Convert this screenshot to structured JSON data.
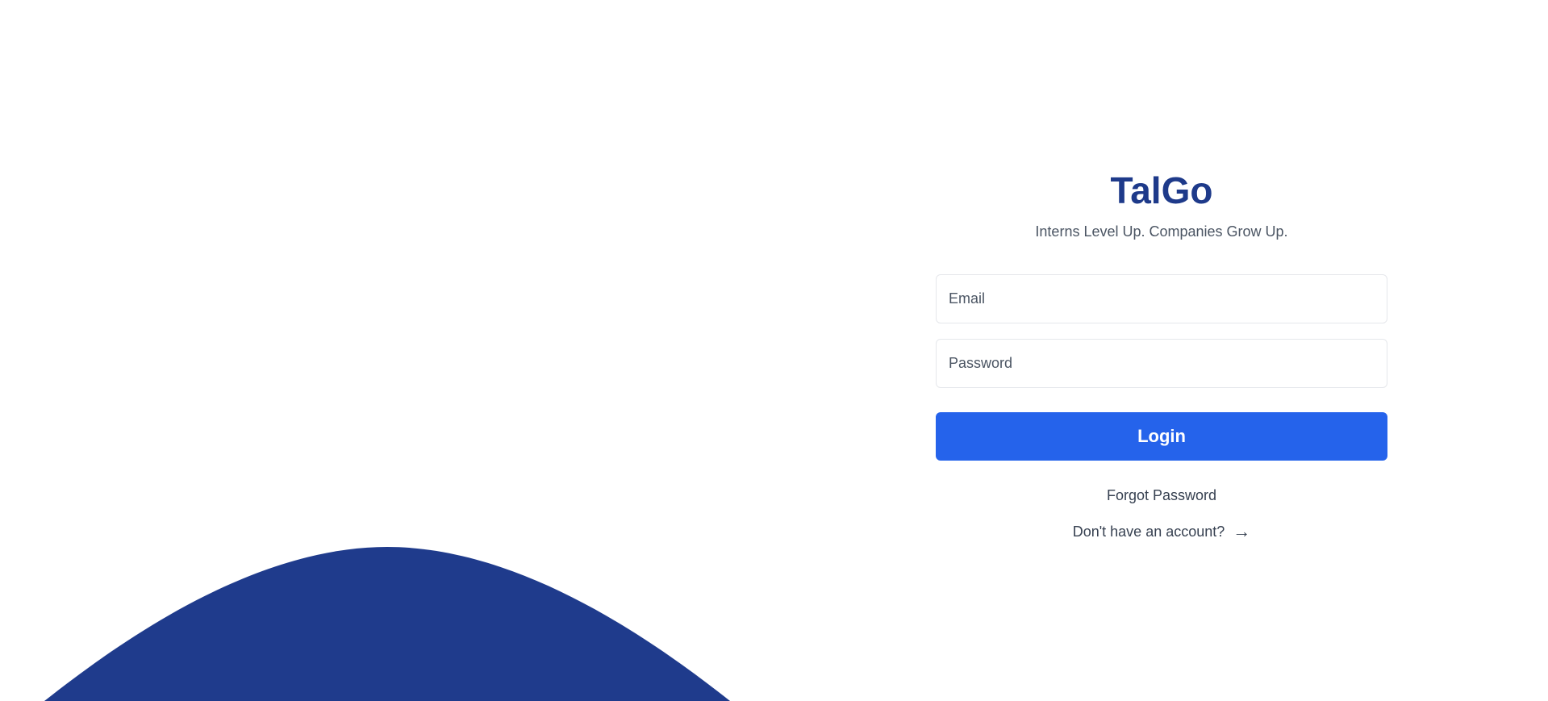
{
  "brand": {
    "name": "TalGo",
    "tagline": "Interns Level Up. Companies Grow Up."
  },
  "form": {
    "email": {
      "value": "",
      "placeholder": "Email"
    },
    "password": {
      "value": "",
      "placeholder": "Password"
    },
    "login_label": "Login",
    "forgot_label": "Forgot Password",
    "signup_label": "Don't have an account?",
    "signup_icon": "arrow-right-icon"
  },
  "colors": {
    "brand": "#1e3a8a",
    "primary_button": "#2563eb",
    "wave": "#1f3b8c"
  }
}
